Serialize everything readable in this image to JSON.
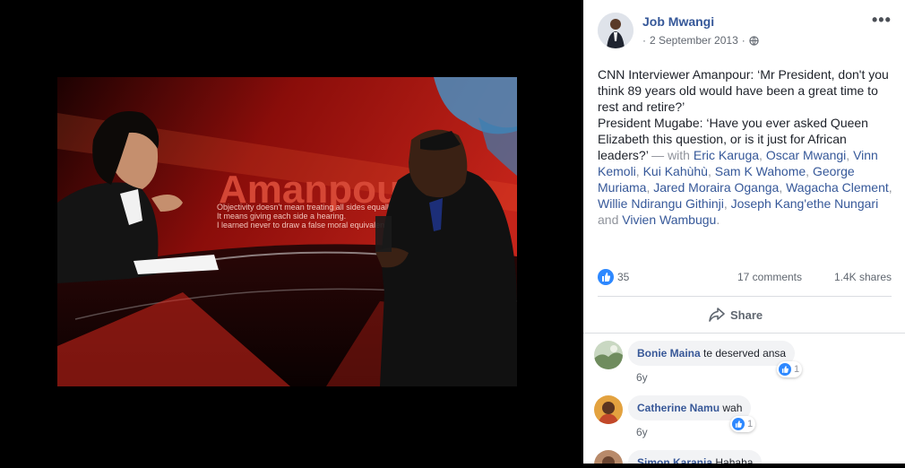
{
  "post": {
    "author": "Job Mwangi",
    "date": "2 September 2013",
    "separator": "·",
    "more": "•••",
    "text_line1": "CNN Interviewer Amanpour: ‘Mr President, don't you think 89 years old would have been a great time to rest and retire?’",
    "text_line2_start": "President Mugabe: ‘Have you ever asked Queen Elizabeth this question, or is it just for African leaders?’",
    "with_prefix": " — with ",
    "tags": [
      "Eric Karuga",
      "Oscar Mwangi",
      "Vinn Kemoli",
      "Kui Kahùhù",
      "Sam K Wahome",
      "George Muriama",
      "Jared Moraira Oganga",
      "Wagacha Clement",
      "Willie Ndirangu Githinji",
      "Joseph Kang'ethe Nungari"
    ],
    "tags_and": " and ",
    "last_tag": "Vivien Wambugu",
    "end": "."
  },
  "stats": {
    "likes": "35",
    "comments": "17 comments",
    "shares": "1.4K shares"
  },
  "actions": {
    "share": "Share"
  },
  "comments": [
    {
      "name": "Bonie Maina",
      "text": "te deserved ansa",
      "reactions": "1",
      "age": "6y"
    },
    {
      "name": "Catherine Namu",
      "text": "wah",
      "reactions": "1",
      "age": "6y"
    },
    {
      "name": "Simon Karanja",
      "text": "Hahaha"
    }
  ],
  "photo": {
    "backdrop_text": "Amanpour",
    "backdrop_lines": [
      "Objectivity doesn't mean treating all sides equally.",
      "It means giving each side a hearing.",
      "I learned never to draw a false moral equivalence."
    ]
  },
  "colors": {
    "link": "#365899",
    "like_blue": "#2d88ff",
    "panel_bg": "#ffffff",
    "viewer_bg": "#000000"
  }
}
